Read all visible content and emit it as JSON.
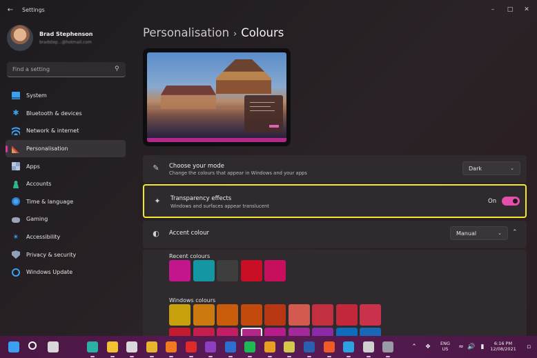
{
  "window": {
    "title": "Settings"
  },
  "profile": {
    "name": "Brad Stephenson",
    "email": "bradstep...@hotmail.com"
  },
  "search": {
    "placeholder": "Find a setting"
  },
  "sidebar": {
    "items": [
      {
        "label": "System",
        "icon": "monitor-icon"
      },
      {
        "label": "Bluetooth & devices",
        "icon": "bluetooth-icon"
      },
      {
        "label": "Network & internet",
        "icon": "wifi-icon"
      },
      {
        "label": "Personalisation",
        "icon": "brush-icon",
        "active": true
      },
      {
        "label": "Apps",
        "icon": "apps-grid-icon"
      },
      {
        "label": "Accounts",
        "icon": "person-icon"
      },
      {
        "label": "Time & language",
        "icon": "globe-clock-icon"
      },
      {
        "label": "Gaming",
        "icon": "gamepad-icon"
      },
      {
        "label": "Accessibility",
        "icon": "accessibility-icon"
      },
      {
        "label": "Privacy & security",
        "icon": "shield-icon"
      },
      {
        "label": "Windows Update",
        "icon": "update-icon"
      }
    ]
  },
  "header": {
    "breadcrumb_parent": "Personalisation",
    "breadcrumb_separator": "›",
    "breadcrumb_current": "Colours"
  },
  "mode": {
    "title": "Choose your mode",
    "subtitle": "Change the colours that appear in Windows and your apps",
    "value": "Dark"
  },
  "transparency": {
    "title": "Transparency effects",
    "subtitle": "Windows and surfaces appear translucent",
    "state_label": "On",
    "enabled": true
  },
  "accent": {
    "title": "Accent colour",
    "value": "Manual",
    "recent_label": "Recent colours",
    "windows_label": "Windows colours",
    "recent_colours": [
      "#c3168c",
      "#1597a3",
      "#3e3e3e",
      "#c80f26",
      "#c80f5e"
    ],
    "windows_colours_row1": [
      "#c7a10b",
      "#cc7a10",
      "#c85c0a",
      "#c24a0c",
      "#b83611",
      "#d35a4e",
      "#c22f3f",
      "#c3283a",
      "#c9324a"
    ],
    "windows_colours_row2": [
      "#c41a2f",
      "#c51e4c",
      "#c41d63",
      "#b3278a",
      "#b81c8b",
      "#a2299a",
      "#8a2aa7",
      "#0f6cbd",
      "#1a67b5"
    ],
    "selected_index_row2": 3
  },
  "taskbar": {
    "apps": [
      {
        "name": "start-icon",
        "color": "#3aa0f0"
      },
      {
        "name": "taskbar-search-icon",
        "color": "#ffffff"
      },
      {
        "name": "task-view-icon",
        "color": "#d8d8d8"
      },
      {
        "name": "edge-icon",
        "color": "#2bb0a6"
      },
      {
        "name": "file-explorer-icon",
        "color": "#f2c230"
      },
      {
        "name": "store-icon",
        "color": "#d9d9d9"
      },
      {
        "name": "chrome-icon",
        "color": "#e8b52c"
      },
      {
        "name": "firefox-icon",
        "color": "#f07a1e"
      },
      {
        "name": "opera-icon",
        "color": "#e02a2a"
      },
      {
        "name": "onenote-icon",
        "color": "#8c3fc0"
      },
      {
        "name": "word-icon",
        "color": "#2b6fd1"
      },
      {
        "name": "spotify-icon",
        "color": "#1db954"
      },
      {
        "name": "maps-icon",
        "color": "#e8a020"
      },
      {
        "name": "notes-icon",
        "color": "#d4c84a"
      },
      {
        "name": "vivaldi-icon",
        "color": "#2a5fb0"
      },
      {
        "name": "brave-icon",
        "color": "#f05a24"
      },
      {
        "name": "telegram-icon",
        "color": "#2aa3e0"
      },
      {
        "name": "tool-icon",
        "color": "#d0d0d0"
      },
      {
        "name": "settings-gear-icon",
        "color": "#9a9aa6"
      }
    ],
    "language_top": "ENG",
    "language_bottom": "US",
    "time": "6:16 PM",
    "date": "12/08/2021"
  },
  "accent_color": "#e44fac",
  "highlight_color": "#f4ea2a"
}
